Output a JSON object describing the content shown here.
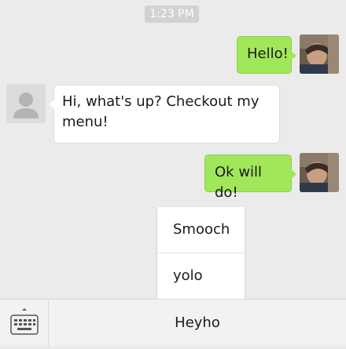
{
  "chat": {
    "timestamp": "1:23 PM",
    "messages": [
      {
        "sender": "me",
        "text": "Hello!"
      },
      {
        "sender": "other",
        "text": "Hi, what's up? Checkout my menu!"
      },
      {
        "sender": "me",
        "text": "Ok will do!"
      }
    ]
  },
  "popup_menu": {
    "items": [
      {
        "label": "Smooch"
      },
      {
        "label": "yolo"
      }
    ]
  },
  "bottom_bar": {
    "keyboard_icon": "keyboard-icon",
    "menu_label": "Heyho"
  },
  "colors": {
    "background": "#ebebeb",
    "outgoing_bubble": "#a0e75a",
    "incoming_bubble": "#ffffff",
    "timestamp_bg": "#d2d2d2"
  }
}
